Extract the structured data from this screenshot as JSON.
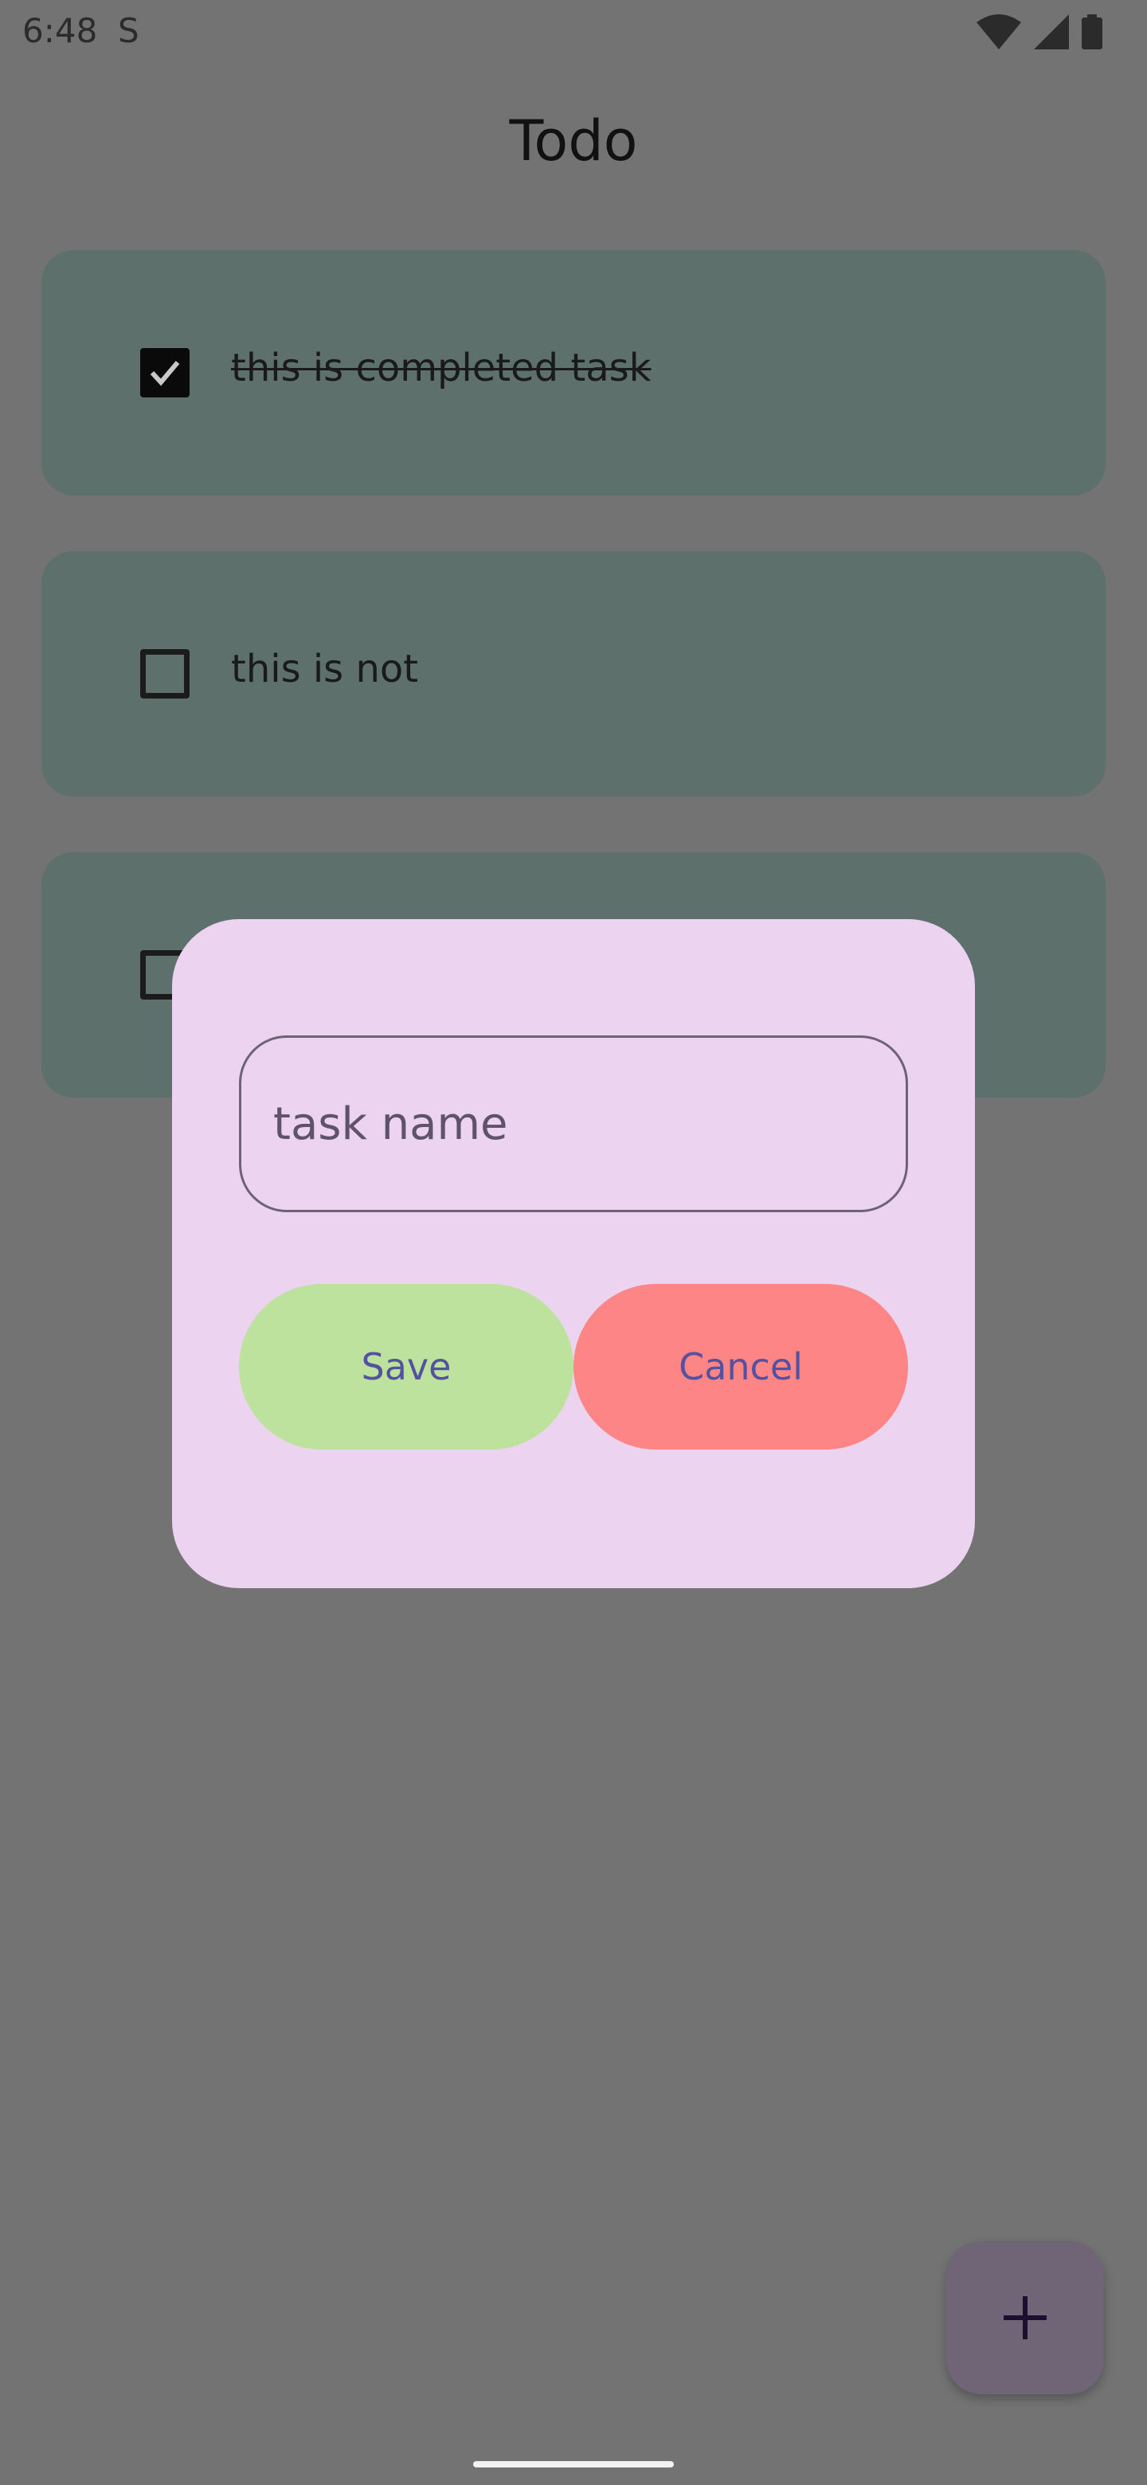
{
  "status_bar": {
    "time": "6:48",
    "app_indicator": "S"
  },
  "app": {
    "title": "Todo"
  },
  "tasks": [
    {
      "text": "this is completed task",
      "completed": true
    },
    {
      "text": "this is not",
      "completed": false
    },
    {
      "text": "",
      "completed": false
    }
  ],
  "dialog": {
    "input_placeholder": "task name",
    "input_value": "",
    "save_label": "Save",
    "cancel_label": "Cancel"
  },
  "fab": {
    "icon": "plus-icon"
  },
  "colors": {
    "scrim": "#737373",
    "card": "#5e706b",
    "dialog": "#ecd3ef",
    "save": "#bde29d",
    "cancel": "#fd8585",
    "button_text": "#5451a0"
  }
}
